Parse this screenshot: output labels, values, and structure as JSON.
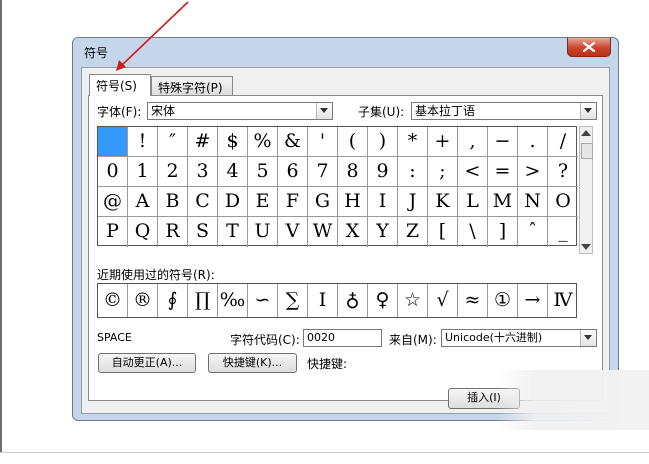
{
  "dialog": {
    "title": "符号",
    "tabs": [
      "符号(S)",
      "特殊字符(P)"
    ]
  },
  "font": {
    "label": "字体(F):",
    "value": "宋体"
  },
  "subset": {
    "label": "子集(U):",
    "value": "基本拉丁语"
  },
  "symbol_grid": [
    [
      "",
      "!",
      "″",
      "#",
      "$",
      "%",
      "&",
      "'",
      "(",
      ")",
      "*",
      "+",
      ",",
      "−",
      ".",
      "/"
    ],
    [
      "0",
      "1",
      "2",
      "3",
      "4",
      "5",
      "6",
      "7",
      "8",
      "9",
      ":",
      ";",
      "<",
      "=",
      ">",
      "?"
    ],
    [
      "@",
      "A",
      "B",
      "C",
      "D",
      "E",
      "F",
      "G",
      "H",
      "I",
      "J",
      "K",
      "L",
      "M",
      "N",
      "O"
    ],
    [
      "P",
      "Q",
      "R",
      "S",
      "T",
      "U",
      "V",
      "W",
      "X",
      "Y",
      "Z",
      "[",
      "\\",
      "]",
      "ˆ",
      "_"
    ]
  ],
  "recent": {
    "label": "近期使用过的符号(R):",
    "symbols": [
      "©",
      "®",
      "∮",
      "∏",
      "‰",
      "∽",
      "∑",
      "Ⅰ",
      "♁",
      "♀",
      "☆",
      "√",
      "≈",
      "①",
      "→",
      "Ⅳ"
    ]
  },
  "char_name": "SPACE",
  "char_code": {
    "label": "字符代码(C):",
    "value": "0020"
  },
  "from": {
    "label": "来自(M):",
    "value": "Unicode(十六进制)"
  },
  "buttons": {
    "autocorrect": "自动更正(A)...",
    "shortcut": "快捷键(K)...",
    "shortcut_label": "快捷键:",
    "insert": "插入(I)"
  },
  "colors": {
    "selected": "#3399ff",
    "close": "#c9452c",
    "arrow": "#d11a1a"
  }
}
